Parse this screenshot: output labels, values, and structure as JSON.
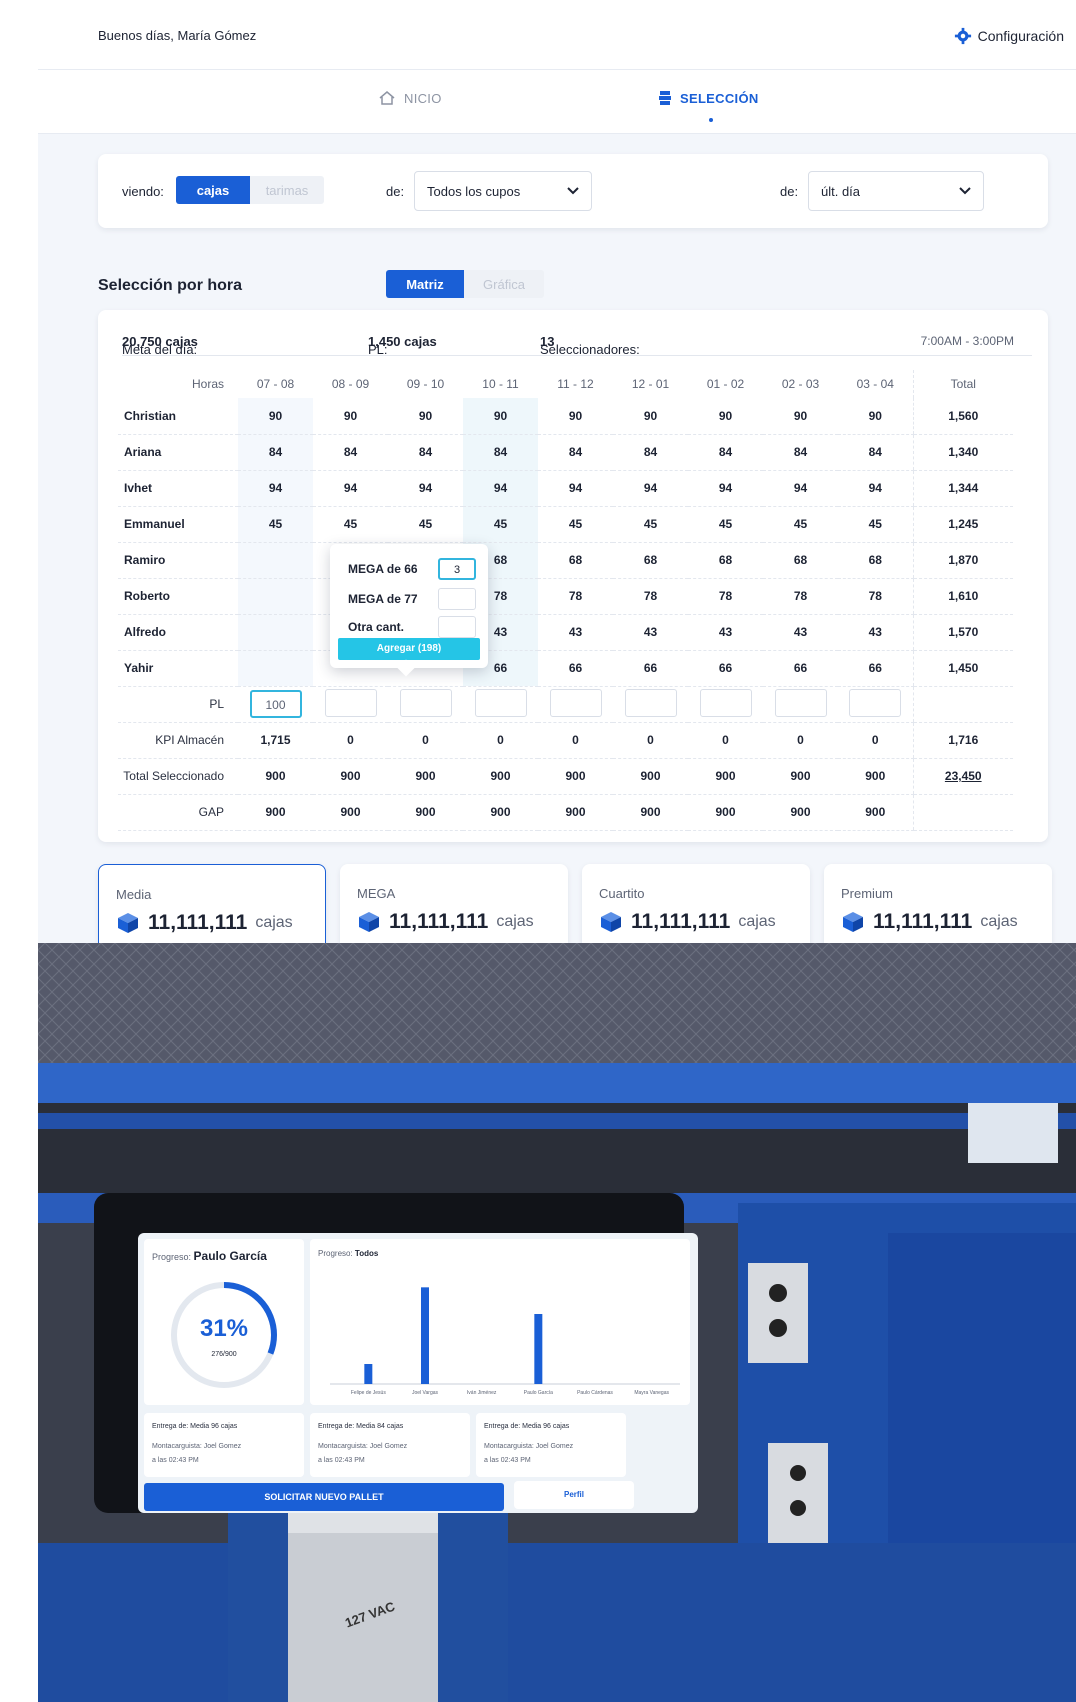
{
  "header": {
    "greeting": "Buenos días, María Gómez",
    "settings_label": "Configuración"
  },
  "nav": {
    "tabs": [
      {
        "label": "NICIO",
        "icon": "home-icon"
      },
      {
        "label": "SELECCIÓN",
        "icon": "box-stack-icon"
      }
    ]
  },
  "filters": {
    "viewing_label": "viendo:",
    "toggle_on": "cajas",
    "toggle_off": "tarimas",
    "from_label": "de:",
    "cupos_value": "Todos los cupos",
    "period_label": "de:",
    "period_value": "últ. día"
  },
  "section": {
    "title": "Selección por hora",
    "view_on": "Matriz",
    "view_off": "Gráfica"
  },
  "summary": {
    "goal_label": "Meta del día:",
    "goal_value": "20,750 cajas",
    "pl_label": "PL:",
    "pl_value": "1,450 cajas",
    "pickers_label": "Seleccionadores:",
    "pickers_value": "13",
    "schedule": "7:00AM - 3:00PM"
  },
  "matrix": {
    "hours_label": "Horas",
    "hours": [
      "07 - 08",
      "08 - 09",
      "09 - 10",
      "10 - 11",
      "11 - 12",
      "12 - 01",
      "01 - 02",
      "02 - 03",
      "03 - 04"
    ],
    "total_label": "Total",
    "rows": [
      {
        "name": "Christian",
        "values": [
          "90",
          "90",
          "90",
          "90",
          "90",
          "90",
          "90",
          "90",
          "90"
        ],
        "total": "1,560"
      },
      {
        "name": "Ariana",
        "values": [
          "84",
          "84",
          "84",
          "84",
          "84",
          "84",
          "84",
          "84",
          "84"
        ],
        "total": "1,340"
      },
      {
        "name": "Ivhet",
        "values": [
          "94",
          "94",
          "94",
          "94",
          "94",
          "94",
          "94",
          "94",
          "94"
        ],
        "total": "1,344"
      },
      {
        "name": "Emmanuel",
        "values": [
          "45",
          "45",
          "45",
          "45",
          "45",
          "45",
          "45",
          "45",
          "45"
        ],
        "total": "1,245"
      },
      {
        "name": "Ramiro",
        "values": [
          "",
          "",
          "",
          "68",
          "68",
          "68",
          "68",
          "68",
          "68"
        ],
        "total": "1,870"
      },
      {
        "name": "Roberto",
        "values": [
          "",
          "",
          "",
          "78",
          "78",
          "78",
          "78",
          "78",
          "78"
        ],
        "total": "1,610"
      },
      {
        "name": "Alfredo",
        "values": [
          "",
          "",
          "",
          "43",
          "43",
          "43",
          "43",
          "43",
          "43"
        ],
        "total": "1,570"
      },
      {
        "name": "Yahir",
        "values": [
          "",
          "",
          "",
          "66",
          "66",
          "66",
          "66",
          "66",
          "66"
        ],
        "total": "1,450"
      }
    ],
    "pl_row_label": "PL",
    "pl_inputs": [
      "100",
      "",
      "",
      "",
      "",
      "",
      "",
      "",
      ""
    ],
    "kpi_label": "KPI Almacén",
    "kpi_values": [
      "1,715",
      "0",
      "0",
      "0",
      "0",
      "0",
      "0",
      "0",
      "0"
    ],
    "kpi_total": "1,716",
    "selected_label": "Total Seleccionado",
    "selected_values": [
      "900",
      "900",
      "900",
      "900",
      "900",
      "900",
      "900",
      "900",
      "900"
    ],
    "selected_total": "23,450",
    "gap_label": "GAP",
    "gap_values": [
      "900",
      "900",
      "900",
      "900",
      "900",
      "900",
      "900",
      "900",
      "900"
    ]
  },
  "popup": {
    "options": [
      {
        "label": "MEGA de 66",
        "value": "3"
      },
      {
        "label": "MEGA de 77",
        "value": ""
      },
      {
        "label": "Otra cant.",
        "value": ""
      }
    ],
    "add_label": "Agregar (198)"
  },
  "kpis": [
    {
      "name": "Media",
      "value": "11,111,111",
      "unit": "cajas"
    },
    {
      "name": "MEGA",
      "value": "11,111,111",
      "unit": "cajas"
    },
    {
      "name": "Cuartito",
      "value": "11,111,111",
      "unit": "cajas"
    },
    {
      "name": "Premium",
      "value": "11,111,111",
      "unit": "cajas"
    }
  ],
  "tablet": {
    "progress_label": "Progreso:",
    "picker": "Paulo García",
    "percent": "31%",
    "count": "276/900",
    "chart_label": "Progreso:",
    "chart_scope": "Todos",
    "delivery_1": "Entrega de: Media 96 cajas",
    "delivery_2": "Entrega de: Media 84 cajas",
    "delivery_3": "Entrega de: Media 96 cajas",
    "forklift": "Montacarguista: Joel Gomez",
    "time": "a las 02:43 PM",
    "request_button": "SOLICITAR NUEVO PALLET",
    "profile_button": "Perfil",
    "chart_data": {
      "type": "bar",
      "categories": [
        "Felipe de Jesús",
        "Joel Vargas",
        "Iván Jiménez",
        "Paulo García",
        "Paulo Cárdenas",
        "Mayra Vanegas"
      ],
      "values": [
        60,
        290,
        0,
        210,
        0,
        0
      ],
      "ylim": [
        0,
        300
      ]
    }
  },
  "labels": {
    "power_box": "127 VAC"
  },
  "colors": {
    "primary": "#1a5fd6",
    "accent": "#25c5e6",
    "background": "#f3f6fb",
    "machine_blue": "#1e4fa8"
  }
}
